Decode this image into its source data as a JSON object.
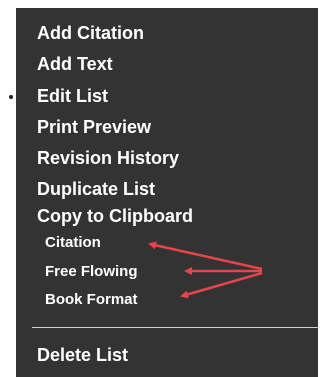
{
  "menu": {
    "items": [
      {
        "label": "Add Citation"
      },
      {
        "label": "Add Text"
      },
      {
        "label": "Edit List"
      },
      {
        "label": "Print Preview"
      },
      {
        "label": "Revision History"
      },
      {
        "label": "Duplicate List"
      },
      {
        "label": "Copy to Clipboard"
      }
    ],
    "sub_items": [
      {
        "label": "Citation"
      },
      {
        "label": "Free Flowing"
      },
      {
        "label": "Book Format"
      }
    ],
    "delete_label": "Delete List"
  },
  "colors": {
    "menu_background": "#333333",
    "text": "#ffffff",
    "annotation_arrow": "#e8454a"
  }
}
